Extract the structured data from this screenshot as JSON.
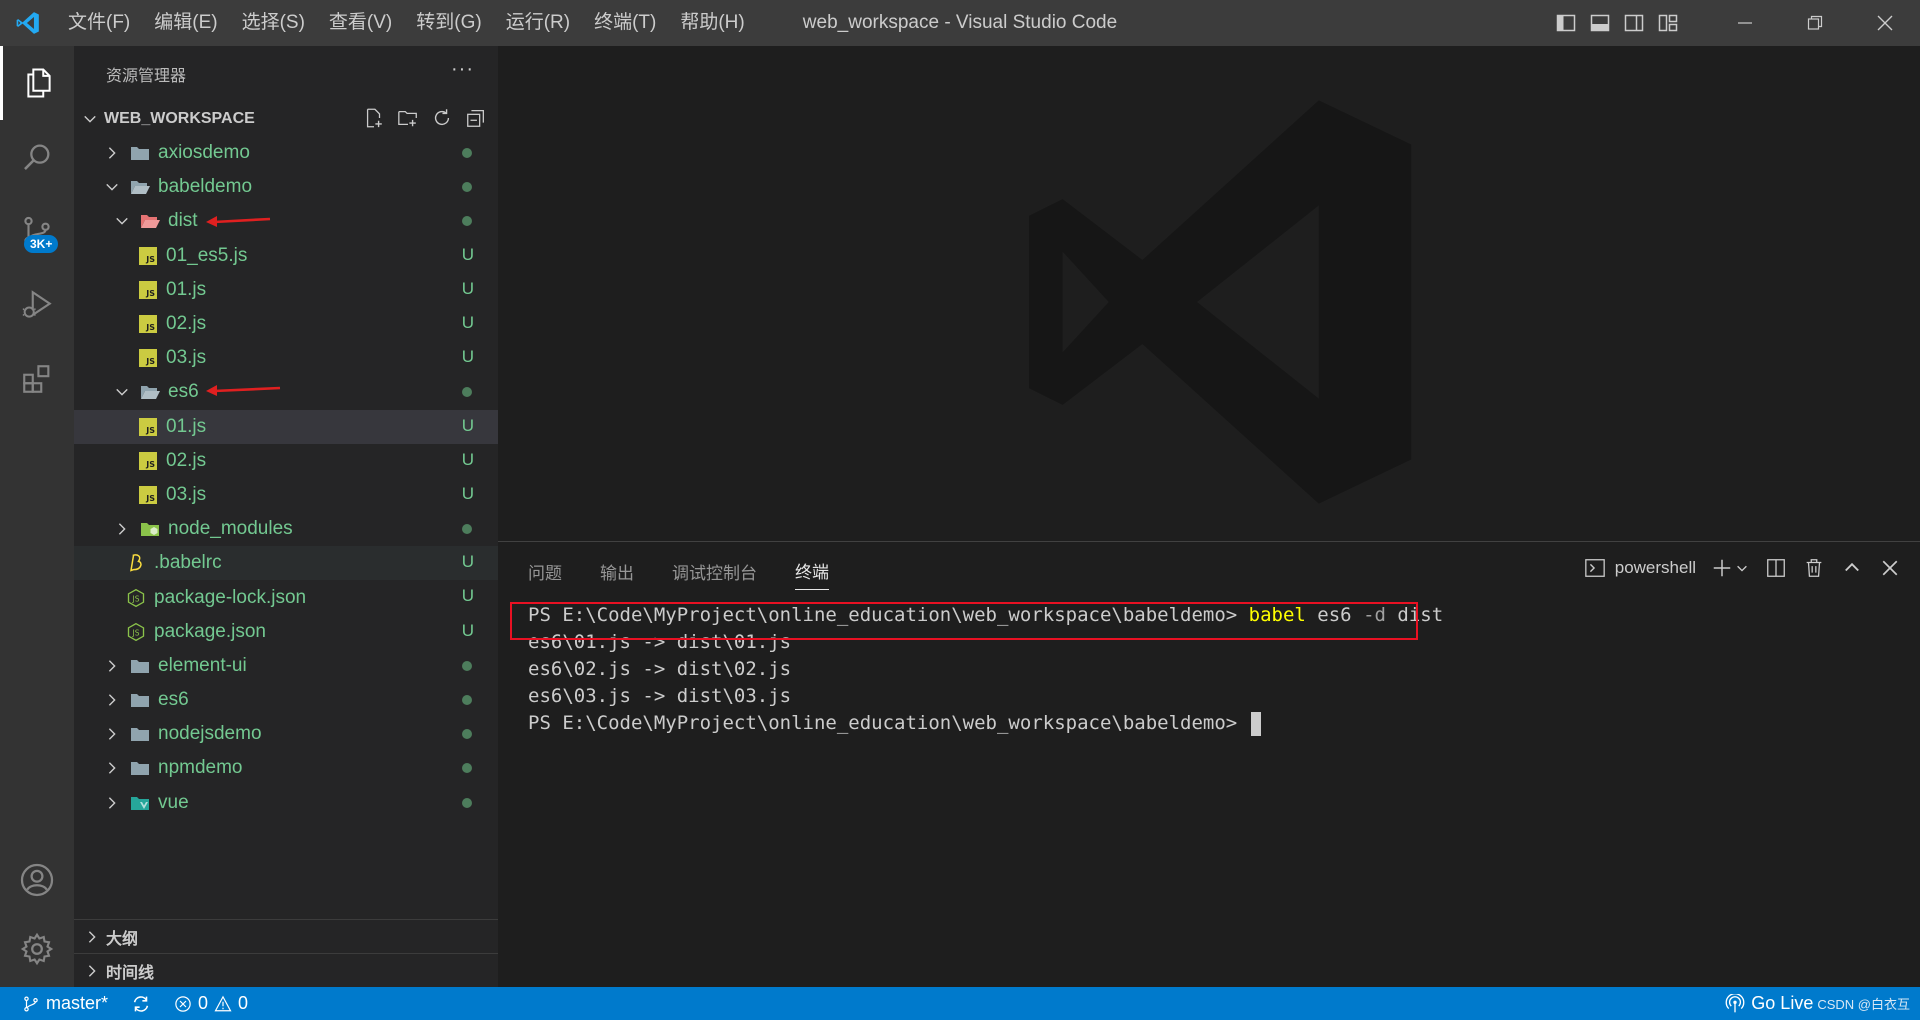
{
  "window": {
    "title": "web_workspace - Visual Studio Code",
    "menu": [
      "文件(F)",
      "编辑(E)",
      "选择(S)",
      "查看(V)",
      "转到(G)",
      "运行(R)",
      "终端(T)",
      "帮助(H)"
    ]
  },
  "activity_bar": {
    "items": [
      "explorer-icon",
      "search-icon",
      "source-control-icon",
      "run-debug-icon",
      "extensions-icon"
    ],
    "scm_badge": "3K+",
    "bottom": [
      "account-icon",
      "manage-gear-icon"
    ]
  },
  "sidebar": {
    "header": "资源管理器",
    "more": "···",
    "workspace": "WEB_WORKSPACE",
    "tree": [
      {
        "label": "axiosdemo",
        "type": "folder",
        "depth": 0,
        "expanded": false,
        "status": "dot"
      },
      {
        "label": "babeldemo",
        "type": "folder",
        "depth": 0,
        "expanded": true,
        "status": "dot"
      },
      {
        "label": "dist",
        "type": "folder-red",
        "depth": 1,
        "expanded": true,
        "status": "dot"
      },
      {
        "label": "01_es5.js",
        "type": "js",
        "depth": 2,
        "status": "U"
      },
      {
        "label": "01.js",
        "type": "js",
        "depth": 2,
        "status": "U"
      },
      {
        "label": "02.js",
        "type": "js",
        "depth": 2,
        "status": "U"
      },
      {
        "label": "03.js",
        "type": "js",
        "depth": 2,
        "status": "U"
      },
      {
        "label": "es6",
        "type": "folder",
        "depth": 1,
        "expanded": true,
        "status": "dot"
      },
      {
        "label": "01.js",
        "type": "js",
        "depth": 2,
        "status": "U",
        "selected": true
      },
      {
        "label": "02.js",
        "type": "js",
        "depth": 2,
        "status": "U"
      },
      {
        "label": "03.js",
        "type": "js",
        "depth": 2,
        "status": "U"
      },
      {
        "label": "node_modules",
        "type": "folder-node",
        "depth": 1,
        "expanded": false,
        "status": "dot"
      },
      {
        "label": ".babelrc",
        "type": "babel",
        "depth": 1,
        "status": "U",
        "focus": true
      },
      {
        "label": "package-lock.json",
        "type": "json",
        "depth": 1,
        "status": "U"
      },
      {
        "label": "package.json",
        "type": "json",
        "depth": 1,
        "status": "U"
      },
      {
        "label": "element-ui",
        "type": "folder",
        "depth": 0,
        "expanded": false,
        "status": "dot"
      },
      {
        "label": "es6",
        "type": "folder",
        "depth": 0,
        "expanded": false,
        "status": "dot"
      },
      {
        "label": "nodejsdemo",
        "type": "folder",
        "depth": 0,
        "expanded": false,
        "status": "dot"
      },
      {
        "label": "npmdemo",
        "type": "folder",
        "depth": 0,
        "expanded": false,
        "status": "dot"
      },
      {
        "label": "vue",
        "type": "folder-vue",
        "depth": 0,
        "expanded": false,
        "status": "dot"
      }
    ],
    "outline": "大纲",
    "timeline": "时间线"
  },
  "panel": {
    "tabs": [
      "问题",
      "输出",
      "调试控制台",
      "终端"
    ],
    "active_tab": "终端",
    "shell": "powershell",
    "terminal": {
      "prompt": "PS E:\\Code\\MyProject\\online_education\\web_workspace\\babeldemo> ",
      "cmd_name": "babel",
      "cmd_args1": " es6 ",
      "cmd_flag": "-d",
      "cmd_args2": " dist",
      "output": [
        "es6\\01.js -> dist\\01.js",
        "es6\\02.js -> dist\\02.js",
        "es6\\03.js -> dist\\03.js"
      ],
      "prompt2": "PS E:\\Code\\MyProject\\online_education\\web_workspace\\babeldemo> "
    }
  },
  "status_bar": {
    "branch": "master*",
    "errors": "0",
    "warnings": "0",
    "go_live": "Go Live",
    "credit": "CSDN @白衣互"
  },
  "colors": {
    "accent": "#007acc",
    "untracked": "#73c991",
    "highlight_box": "#e81123"
  }
}
